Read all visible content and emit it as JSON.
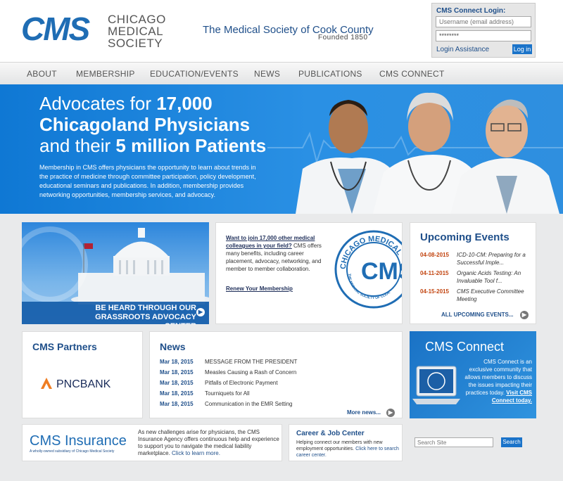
{
  "header": {
    "logo_mark": "CMS",
    "logo_text": "CHICAGO\nMEDICAL\nSOCIETY",
    "tagline": "The Medical Society of Cook County",
    "founded": "Founded 1850"
  },
  "login": {
    "title": "CMS Connect Login:",
    "username_placeholder": "Username (email address)",
    "password_value": "********",
    "assistance": "Login Assistance",
    "button": "Log in"
  },
  "nav": {
    "items": [
      "ABOUT",
      "MEMBERSHIP",
      "EDUCATION/EVENTS",
      "NEWS",
      "PUBLICATIONS",
      "CMS CONNECT"
    ]
  },
  "hero": {
    "line1_pre": "Advocates for ",
    "line1_strong": "17,000",
    "line2": "Chicagoland Physicians",
    "line3_pre": "and their ",
    "line3_strong": "5 million Patients",
    "body": "Membership in CMS offers physicians the opportunity to learn about trends in the practice of medicine through committee participation, policy development, educational seminars and publications. In addition, membership provides networking opportunities, membership services, and advocacy."
  },
  "advocacy": {
    "banner": "BE HEARD THROUGH OUR GRASSROOTS ADVOCACY CENTER"
  },
  "join": {
    "lead": "Want to join 17,000 other medical colleagues in your field?",
    "body": " CMS offers many benefits, including career placement, advocacy, networking, and member to member collaboration.",
    "renew": "Renew Your Membership",
    "seal_top": "CHICAGO MEDICAL",
    "seal_bottom": "THE MEDICAL SOCIETY OF COOK"
  },
  "events": {
    "title": "Upcoming Events",
    "items": [
      {
        "date": "04-08-2015",
        "title": "ICD-10-CM: Preparing for a Successful Imple..."
      },
      {
        "date": "04-11-2015",
        "title": "Organic Acids Testing: An Invaluable Tool f..."
      },
      {
        "date": "04-15-2015",
        "title": "CMS Executive Committee Meeting"
      }
    ],
    "all": "ALL UPCOMING EVENTS..."
  },
  "partners": {
    "title": "CMS Partners",
    "logo": "PNCBANK"
  },
  "news": {
    "title": "News",
    "items": [
      {
        "date": "Mar 18, 2015",
        "headline": "MESSAGE FROM THE PRESIDENT"
      },
      {
        "date": "Mar 18, 2015",
        "headline": "Measles Causing a Rash of Concern"
      },
      {
        "date": "Mar 18, 2015",
        "headline": "Pitfalls of Electronic Payment"
      },
      {
        "date": "Mar 18, 2015",
        "headline": "Tourniquets for All"
      },
      {
        "date": "Mar 18, 2015",
        "headline": "Communication in the EMR Setting"
      }
    ],
    "more": "More news..."
  },
  "connect": {
    "title": "CMS Connect",
    "body": "CMS Connect is an exclusive community that allows members to discuss the issues impacting their practices today.",
    "link": "Visit CMS Connect today."
  },
  "insurance": {
    "logo": "CMS Insurance",
    "sub": "A wholly-owned subsidiary of Chicago Medical Society",
    "body": "As new challenges arise for physicians, the CMS Insurance Agency offers continuous help and experience to support you to navigate the medical liability marketplace.",
    "link": "Click to learn more."
  },
  "career": {
    "title": "Career & Job Center",
    "body": "Helping connect our members with new employment opportunities.",
    "link": "Click here to search career center."
  },
  "search": {
    "placeholder": "Search Site",
    "button": "Search"
  },
  "colors": {
    "brand_blue": "#1f6db4",
    "hero_blue": "#1a80d8",
    "event_date": "#c2440f"
  }
}
